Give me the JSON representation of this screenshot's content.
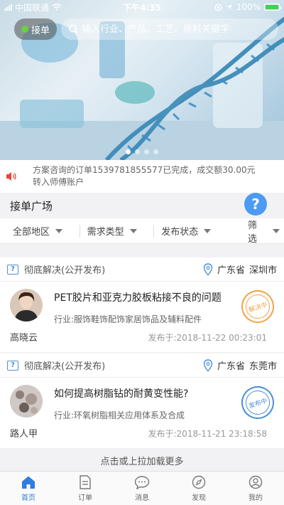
{
  "status_bar": {
    "carrier": "中国联通",
    "time": "下午4:35",
    "battery": "100%"
  },
  "banner": {
    "jiedan_label": "接单",
    "search_placeholder": "输入行业、产品、工艺、原料关键字",
    "page_count": 4,
    "active_page": 0
  },
  "notice": {
    "text": "方案咨询的订单1539781855577已完成，成交额30.00元转入师傅账户"
  },
  "section": {
    "title": "接单广场",
    "help_symbol": "?"
  },
  "filters": [
    {
      "label": "全部地区"
    },
    {
      "label": "需求类型"
    },
    {
      "label": "发布状态"
    },
    {
      "label": "筛选"
    }
  ],
  "cards": [
    {
      "category": "彻底解决(公开发布)",
      "province": "广东省",
      "city": "深圳市",
      "title": "PET胶片和亚克力胶板粘接不良的问题",
      "industry": "行业:服饰鞋饰配饰家居饰品及辅料配件",
      "user": "高晓云",
      "published": "发布于:2018-11-22 00:23:01",
      "stamp": "解决中",
      "stamp_color": "#f2a44a"
    },
    {
      "category": "彻底解决(公开发布)",
      "province": "广东省",
      "city": "东莞市",
      "title": "如何提高树脂钻的耐黄变性能?",
      "industry": "行业:环氧树脂相关应用体系及合成",
      "user": "路人甲",
      "published": "发布于:2018-11-21 23:18:58",
      "stamp": "发布中",
      "stamp_color": "#4b8fd9"
    }
  ],
  "load_more": "点击或上拉加载更多",
  "tabs": [
    {
      "label": "首页",
      "icon": "home-icon",
      "active": true
    },
    {
      "label": "订单",
      "icon": "order-icon",
      "active": false
    },
    {
      "label": "消息",
      "icon": "message-icon",
      "active": false
    },
    {
      "label": "发现",
      "icon": "compass-icon",
      "active": false
    },
    {
      "label": "我的",
      "icon": "profile-icon",
      "active": false
    }
  ],
  "colors": {
    "accent": "#2f7ee0",
    "help": "#4b9af3",
    "notice_icon": "#e8453c"
  }
}
